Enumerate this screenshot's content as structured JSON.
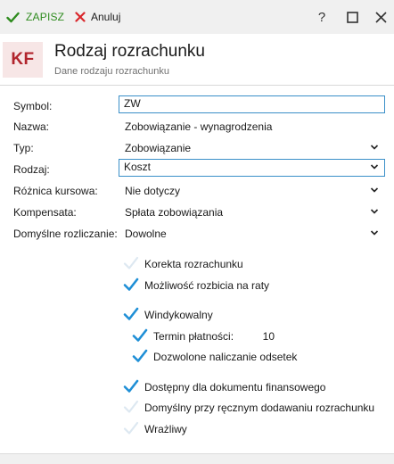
{
  "toolbar": {
    "save_label": "ZAPISZ",
    "cancel_label": "Anuluj",
    "help_label": "?"
  },
  "header": {
    "badge": "KF",
    "title": "Rodzaj rozrachunku",
    "subtitle": "Dane rodzaju rozrachunku"
  },
  "form": {
    "symbol": {
      "label": "Symbol:",
      "value": "ZW"
    },
    "nazwa": {
      "label": "Nazwa:",
      "value": "Zobowiązanie - wynagrodzenia"
    },
    "typ": {
      "label": "Typ:",
      "value": "Zobowiązanie"
    },
    "rodzaj": {
      "label": "Rodzaj:",
      "value": "Koszt"
    },
    "roznica": {
      "label": "Różnica kursowa:",
      "value": "Nie dotyczy"
    },
    "kompensata": {
      "label": "Kompensata:",
      "value": "Spłata zobowiązania"
    },
    "domyslne": {
      "label": "Domyślne rozliczanie:",
      "value": "Dowolne"
    }
  },
  "checks": {
    "korekta": {
      "label": "Korekta rozrachunku",
      "checked": false
    },
    "mozliwosc": {
      "label": "Możliwość rozbicia na raty",
      "checked": true
    },
    "windykowalny": {
      "label": "Windykowalny",
      "checked": true
    },
    "termin": {
      "label": "Termin płatności:",
      "checked": true,
      "value": "10"
    },
    "dozwolone": {
      "label": "Dozwolone naliczanie odsetek",
      "checked": true
    },
    "dostepny": {
      "label": "Dostępny dla dokumentu finansowego",
      "checked": true
    },
    "domyslny": {
      "label": "Domyślny przy ręcznym dodawaniu rozrachunku",
      "checked": false
    },
    "wrazliwy": {
      "label": "Wrażliwy",
      "checked": false
    }
  },
  "colors": {
    "accent_green": "#2e8b1e",
    "cancel_red": "#d9262b",
    "check_blue": "#1f8fd6",
    "focus_border": "#3a8fc8",
    "badge_text": "#b1242c",
    "badge_bg": "#f7e6e6"
  },
  "icons": {
    "save": "checkmark-icon",
    "cancel": "x-icon",
    "maximize": "square-icon",
    "close": "close-icon",
    "dropdown": "chevron-down-icon"
  }
}
